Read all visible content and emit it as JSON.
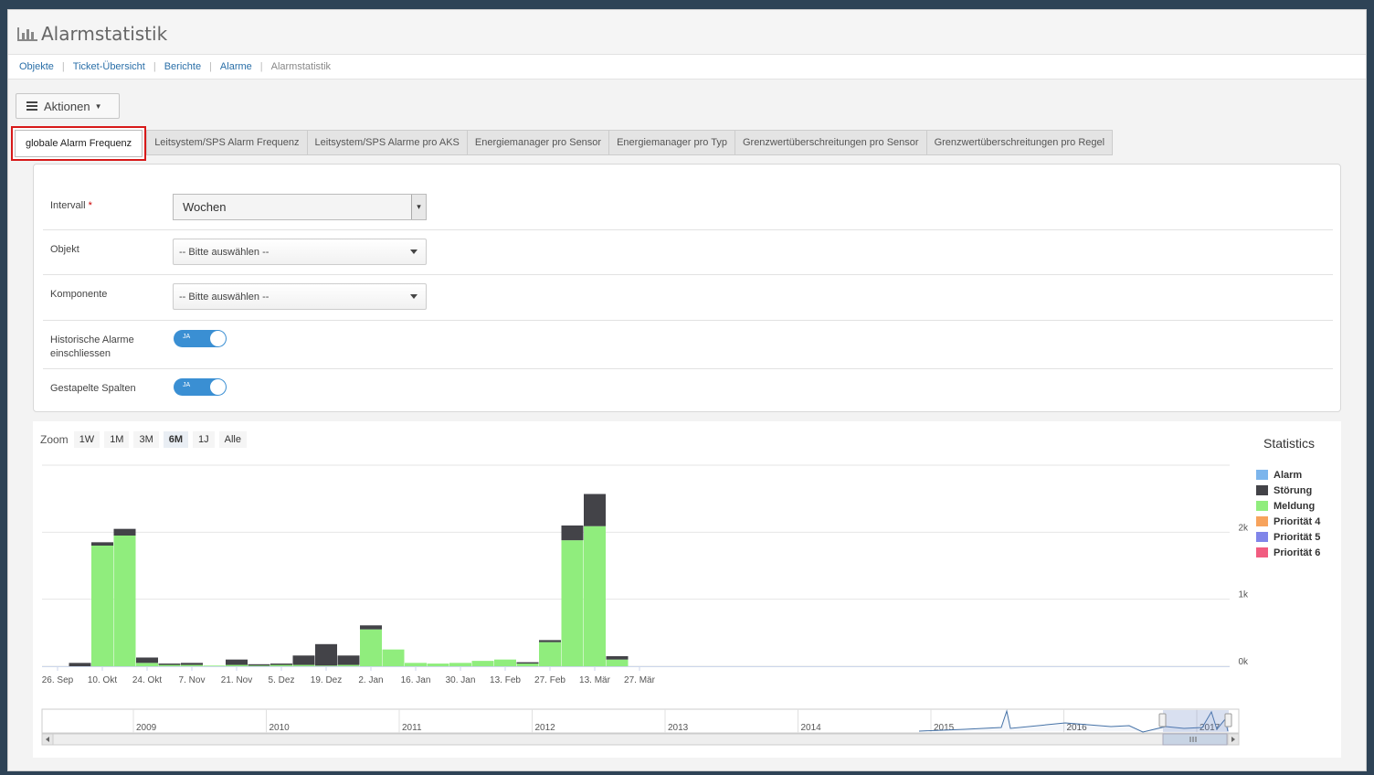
{
  "page": {
    "title": "Alarmstatistik",
    "title_icon": "bar-chart-icon"
  },
  "breadcrumb": {
    "items": [
      "Objekte",
      "Ticket-Übersicht",
      "Berichte",
      "Alarme"
    ],
    "current": "Alarmstatistik"
  },
  "actions": {
    "label": "Aktionen",
    "icon": "hamburger-icon"
  },
  "tabs": [
    {
      "label": "globale Alarm Frequenz",
      "active": true
    },
    {
      "label": "Leitsystem/SPS Alarm Frequenz",
      "active": false
    },
    {
      "label": "Leitsystem/SPS Alarme pro AKS",
      "active": false
    },
    {
      "label": "Energiemanager pro Sensor",
      "active": false
    },
    {
      "label": "Energiemanager pro Typ",
      "active": false
    },
    {
      "label": "Grenzwertüberschreitungen pro Sensor",
      "active": false
    },
    {
      "label": "Grenzwertüberschreitungen pro Regel",
      "active": false
    }
  ],
  "form": {
    "intervall": {
      "label": "Intervall",
      "required_mark": "*",
      "value": "Wochen"
    },
    "objekt": {
      "label": "Objekt",
      "value": "-- Bitte auswählen --"
    },
    "komponente": {
      "label": "Komponente",
      "value": "-- Bitte auswählen --"
    },
    "historische": {
      "label_line1": "Historische Alarme",
      "label_line2": "einschliessen",
      "toggle": "JA",
      "on": true
    },
    "gestapelt": {
      "label": "Gestapelte Spalten",
      "toggle": "JA",
      "on": true
    }
  },
  "zoom": {
    "label": "Zoom",
    "buttons": [
      "1W",
      "1M",
      "3M",
      "6M",
      "1J",
      "Alle"
    ],
    "selected": "6M"
  },
  "colors": {
    "alarm": "#7cb5ec",
    "stoerung": "#434348",
    "meldung": "#90ed7d",
    "prio4": "#f7a35c",
    "prio5": "#8085e9",
    "prio6": "#f15c80"
  },
  "chart_data": {
    "type": "bar",
    "stacked": true,
    "title": "Statistics",
    "xlabel": "",
    "ylabel": "",
    "ylim": [
      0,
      3000
    ],
    "yticks": [
      "0k",
      "1k",
      "2k"
    ],
    "legend_position": "right",
    "grid": true,
    "x_tick_labels": [
      "26. Sep",
      "10. Okt",
      "24. Okt",
      "7. Nov",
      "21. Nov",
      "5. Dez",
      "19. Dez",
      "2. Jan",
      "16. Jan",
      "30. Jan",
      "13. Feb",
      "27. Feb",
      "13. Mär",
      "27. Mär"
    ],
    "categories": [
      "2016-10-03",
      "2016-10-10",
      "2016-10-17",
      "2016-10-24",
      "2016-10-31",
      "2016-11-07",
      "2016-11-14",
      "2016-11-21",
      "2016-11-28",
      "2016-12-05",
      "2016-12-12",
      "2016-12-19",
      "2016-12-26",
      "2017-01-02",
      "2017-01-09",
      "2017-01-16",
      "2017-01-23",
      "2017-01-30",
      "2017-02-06",
      "2017-02-13",
      "2017-02-20",
      "2017-02-27",
      "2017-03-06",
      "2017-03-13",
      "2017-03-20"
    ],
    "series": [
      {
        "name": "Alarm",
        "values": [
          0,
          0,
          0,
          0,
          0,
          0,
          0,
          0,
          0,
          0,
          0,
          0,
          0,
          0,
          0,
          0,
          0,
          0,
          0,
          0,
          0,
          0,
          0,
          0,
          0
        ]
      },
      {
        "name": "Störung",
        "values": [
          50,
          50,
          100,
          80,
          20,
          30,
          0,
          80,
          10,
          10,
          140,
          320,
          140,
          60,
          0,
          0,
          0,
          0,
          0,
          0,
          10,
          30,
          220,
          480,
          50
        ]
      },
      {
        "name": "Meldung",
        "values": [
          0,
          1800,
          1950,
          50,
          20,
          20,
          10,
          20,
          20,
          30,
          20,
          10,
          20,
          550,
          250,
          50,
          40,
          50,
          80,
          100,
          50,
          360,
          1880,
          2090,
          100
        ]
      },
      {
        "name": "Priorität 4",
        "values": [
          0,
          0,
          0,
          0,
          0,
          0,
          0,
          0,
          0,
          0,
          0,
          0,
          0,
          0,
          0,
          0,
          0,
          0,
          0,
          0,
          0,
          0,
          0,
          0,
          0
        ]
      },
      {
        "name": "Priorität 5",
        "values": [
          0,
          0,
          0,
          0,
          0,
          0,
          0,
          0,
          0,
          0,
          0,
          0,
          0,
          0,
          0,
          0,
          0,
          0,
          0,
          0,
          0,
          0,
          0,
          0,
          0
        ]
      },
      {
        "name": "Priorität 6",
        "values": [
          0,
          0,
          0,
          0,
          0,
          0,
          0,
          0,
          0,
          0,
          0,
          0,
          0,
          0,
          0,
          0,
          0,
          0,
          0,
          0,
          0,
          0,
          0,
          0,
          0
        ]
      }
    ],
    "navigator": {
      "year_labels": [
        "2009",
        "2010",
        "2011",
        "2012",
        "2013",
        "2014",
        "2015",
        "2016",
        "2017"
      ]
    }
  }
}
